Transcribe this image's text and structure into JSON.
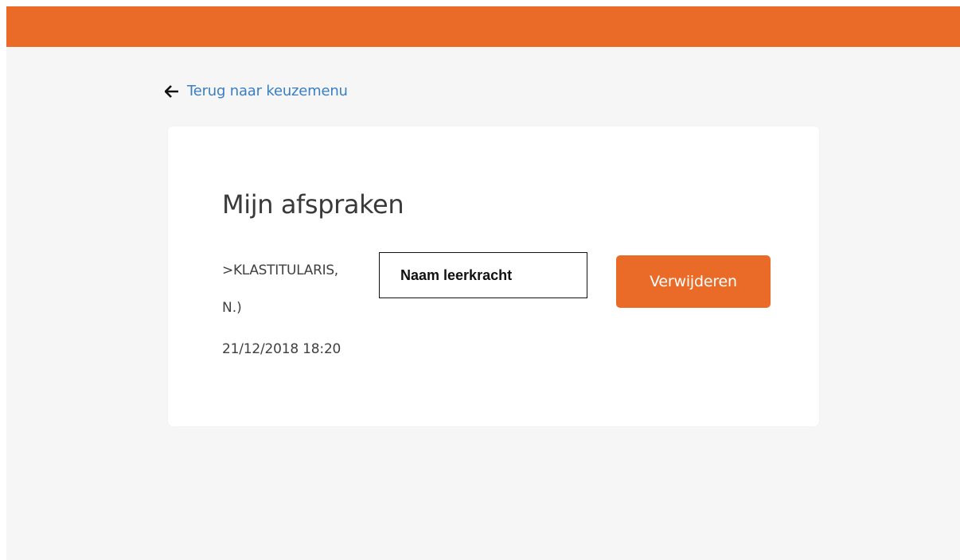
{
  "colors": {
    "accent": "#ea6a27",
    "link": "#3a7fc1",
    "background": "#f6f6f6",
    "card": "#ffffff"
  },
  "back_link": {
    "icon": "arrow-left-icon",
    "label": "Terug naar keuzemenu"
  },
  "card": {
    "title": "Mijn afspraken",
    "appointment": {
      "line1": ">KLASTITULARIS,",
      "line2": "N.)",
      "datetime": "21/12/2018 18:20",
      "redacted_name": "Naam leerkracht",
      "delete_label": "Verwijderen"
    }
  }
}
